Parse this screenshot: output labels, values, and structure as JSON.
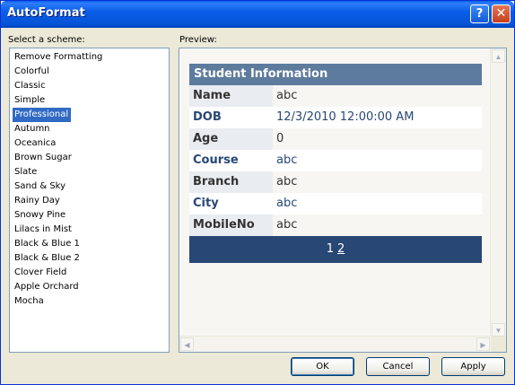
{
  "window": {
    "title": "AutoFormat",
    "help_glyph": "?",
    "close_glyph": "✕"
  },
  "labels": {
    "select_scheme": "Select a scheme:",
    "preview": "Preview:"
  },
  "schemes": [
    "Remove Formatting",
    "Colorful",
    "Classic",
    "Simple",
    "Professional",
    "Autumn",
    "Oceanica",
    "Brown Sugar",
    "Slate",
    "Sand & Sky",
    "Rainy Day",
    "Snowy Pine",
    "Lilacs in Mist",
    "Black & Blue 1",
    "Black & Blue 2",
    "Clover Field",
    "Apple Orchard",
    "Mocha"
  ],
  "selected_scheme": "Professional",
  "preview": {
    "header": "Student Information",
    "rows": [
      {
        "label": "Name",
        "value": "abc"
      },
      {
        "label": "DOB",
        "value": "12/3/2010 12:00:00 AM"
      },
      {
        "label": "Age",
        "value": "0"
      },
      {
        "label": "Course",
        "value": "abc"
      },
      {
        "label": "Branch",
        "value": "abc"
      },
      {
        "label": "City",
        "value": "abc"
      },
      {
        "label": "MobileNo",
        "value": "abc"
      }
    ],
    "pager": {
      "current": "1",
      "next": "2"
    }
  },
  "buttons": {
    "ok": "OK",
    "cancel": "Cancel",
    "apply": "Apply"
  },
  "colors": {
    "header_bg": "#5d7b9d",
    "pager_bg": "#284775",
    "selection": "#316ac5"
  },
  "icons": {
    "scroll_up": "▲",
    "scroll_down": "▼",
    "scroll_left": "◀",
    "scroll_right": "▶"
  }
}
